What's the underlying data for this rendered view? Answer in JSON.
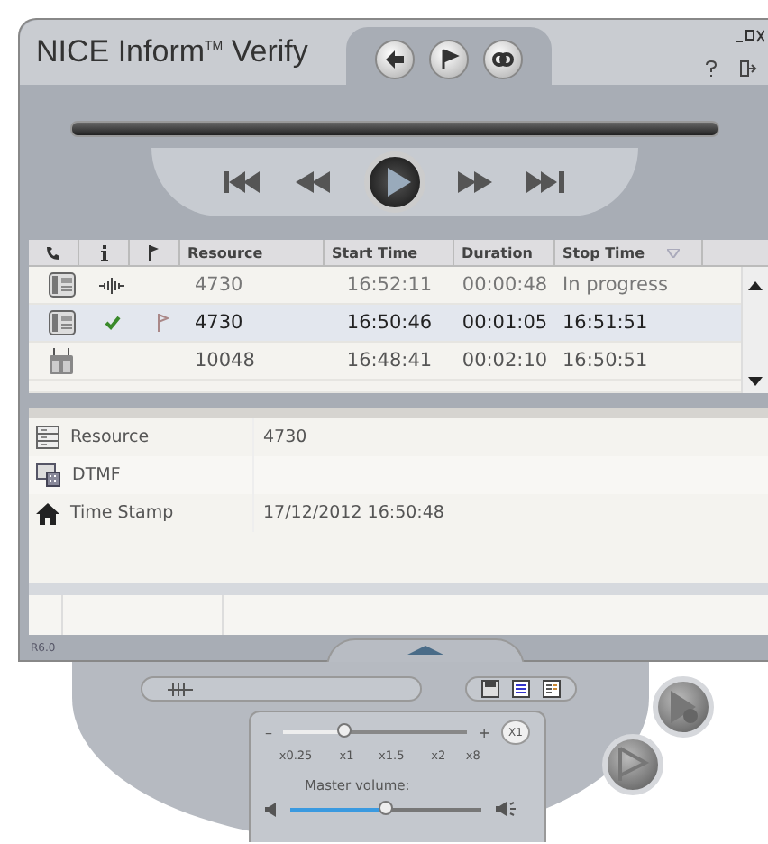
{
  "window": {
    "title": "NICE Inform",
    "trademark": "TM",
    "title_suffix": " Verify"
  },
  "table": {
    "columns": [
      "Resource",
      "Start Time",
      "Duration",
      "Stop Time"
    ],
    "rows": [
      {
        "kind": "phone",
        "recording": true,
        "checked": false,
        "flagged": false,
        "selected": false,
        "cells": [
          "4730",
          "16:52:11",
          "00:00:48",
          "In progress"
        ]
      },
      {
        "kind": "phone",
        "recording": false,
        "checked": true,
        "flagged": true,
        "selected": true,
        "cells": [
          "4730",
          "16:50:46",
          "00:01:05",
          "16:51:51"
        ]
      },
      {
        "kind": "radio",
        "recording": false,
        "checked": false,
        "flagged": false,
        "selected": false,
        "cells": [
          "10048",
          "16:48:41",
          "00:02:10",
          "16:50:51"
        ]
      }
    ]
  },
  "details": [
    {
      "kind": "resource",
      "label": "Resource",
      "value": "4730"
    },
    {
      "kind": "dtmf",
      "label": "DTMF"
    },
    {
      "kind": "time",
      "label": "Time Stamp",
      "value": "17/12/2012 16:50:48"
    }
  ],
  "status_bar": {
    "version": "R6.0"
  },
  "speed": {
    "minus": "–",
    "plus": "+",
    "level": 0.33,
    "ticks": [
      "x0.25",
      "x1",
      "x1.5",
      "x2",
      "x8"
    ],
    "badge": "X1"
  },
  "volume": {
    "label": "Master volume:",
    "level": 0.5
  }
}
